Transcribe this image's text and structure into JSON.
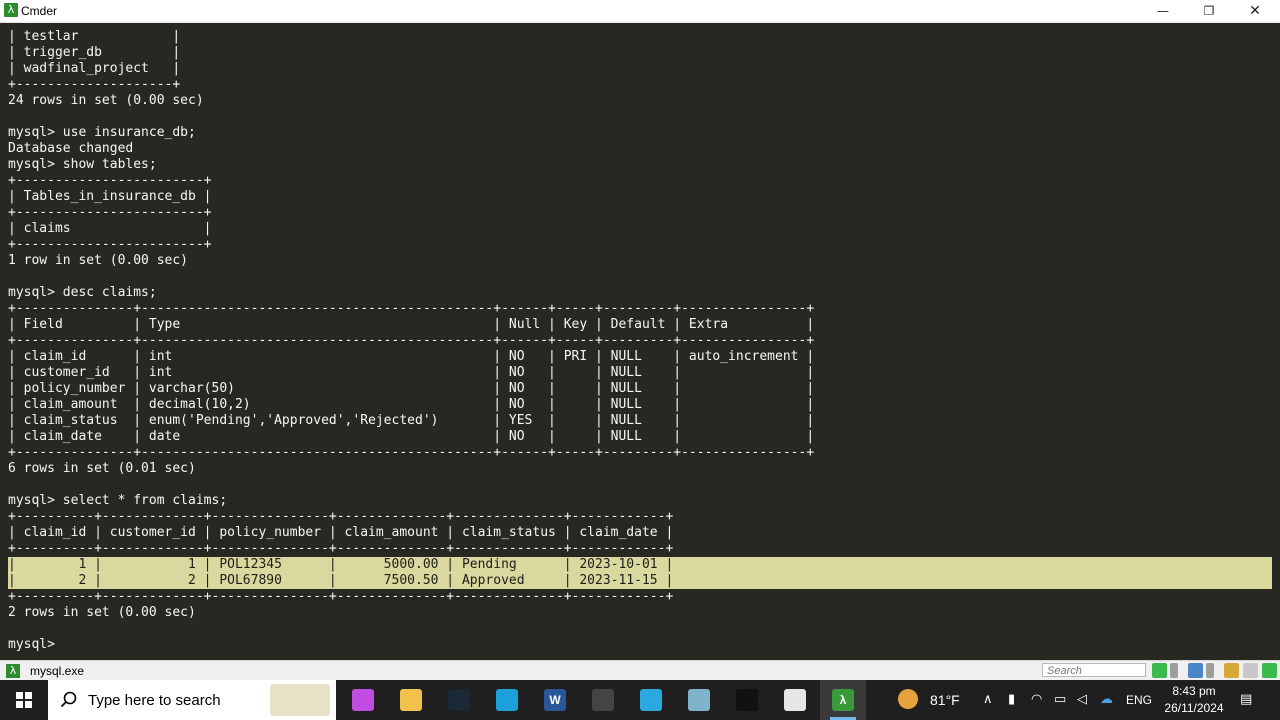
{
  "window": {
    "title": "Cmder",
    "minimize": "—",
    "maximize": "❐",
    "close": "✕",
    "app_glyph": "λ"
  },
  "terminal": {
    "lines": [
      "| testlar            |",
      "| trigger_db         |",
      "| wadfinal_project   |",
      "+--------------------+",
      "24 rows in set (0.00 sec)",
      "",
      "mysql> use insurance_db;",
      "Database changed",
      "mysql> show tables;",
      "+------------------------+",
      "| Tables_in_insurance_db |",
      "+------------------------+",
      "| claims                 |",
      "+------------------------+",
      "1 row in set (0.00 sec)",
      "",
      "mysql> desc claims;",
      "+---------------+---------------------------------------------+------+-----+---------+----------------+",
      "| Field         | Type                                        | Null | Key | Default | Extra          |",
      "+---------------+---------------------------------------------+------+-----+---------+----------------+",
      "| claim_id      | int                                         | NO   | PRI | NULL    | auto_increment |",
      "| customer_id   | int                                         | NO   |     | NULL    |                |",
      "| policy_number | varchar(50)                                 | NO   |     | NULL    |                |",
      "| claim_amount  | decimal(10,2)                               | NO   |     | NULL    |                |",
      "| claim_status  | enum('Pending','Approved','Rejected')       | YES  |     | NULL    |                |",
      "| claim_date    | date                                        | NO   |     | NULL    |                |",
      "+---------------+---------------------------------------------+------+-----+---------+----------------+",
      "6 rows in set (0.01 sec)",
      "",
      "mysql> select * from claims;",
      "+----------+-------------+---------------+--------------+--------------+------------+",
      "| claim_id | customer_id | policy_number | claim_amount | claim_status | claim_date |",
      "+----------+-------------+---------------+--------------+--------------+------------+",
      "|        1 |           1 | POL12345      |      5000.00 | Pending      | 2023-10-01 |",
      "|        2 |           2 | POL67890      |      7500.50 | Approved     | 2023-11-15 |",
      "+----------+-------------+---------------+--------------+--------------+------------+",
      "2 rows in set (0.00 sec)",
      "",
      "mysql> "
    ],
    "highlighted_rows": [
      33,
      34
    ]
  },
  "statusbar": {
    "tab_label": "mysql.exe",
    "search_placeholder": "Search"
  },
  "taskbar": {
    "search_label": "Type here to search",
    "weather": "81°F",
    "language": "ENG",
    "time": "8:43 pm",
    "date": "26/11/2024",
    "apps": [
      {
        "name": "copilot",
        "glyph": "",
        "color": "#c04de0"
      },
      {
        "name": "file-explorer",
        "glyph": "",
        "color": "#f2c14e"
      },
      {
        "name": "steam",
        "glyph": "",
        "color": "#1b2838"
      },
      {
        "name": "edge",
        "glyph": "",
        "color": "#1ca0d9"
      },
      {
        "name": "word",
        "glyph": "W",
        "color": "#2b579a"
      },
      {
        "name": "screen-recorder",
        "glyph": "",
        "color": "#444444"
      },
      {
        "name": "app-blue",
        "glyph": "",
        "color": "#2aa8e0"
      },
      {
        "name": "app-pen",
        "glyph": "",
        "color": "#7fb3c9"
      },
      {
        "name": "terminal",
        "glyph": "",
        "color": "#111111"
      },
      {
        "name": "store",
        "glyph": "",
        "color": "#e6e6e6"
      },
      {
        "name": "cmder",
        "glyph": "λ",
        "color": "#3a9a3a"
      }
    ]
  }
}
